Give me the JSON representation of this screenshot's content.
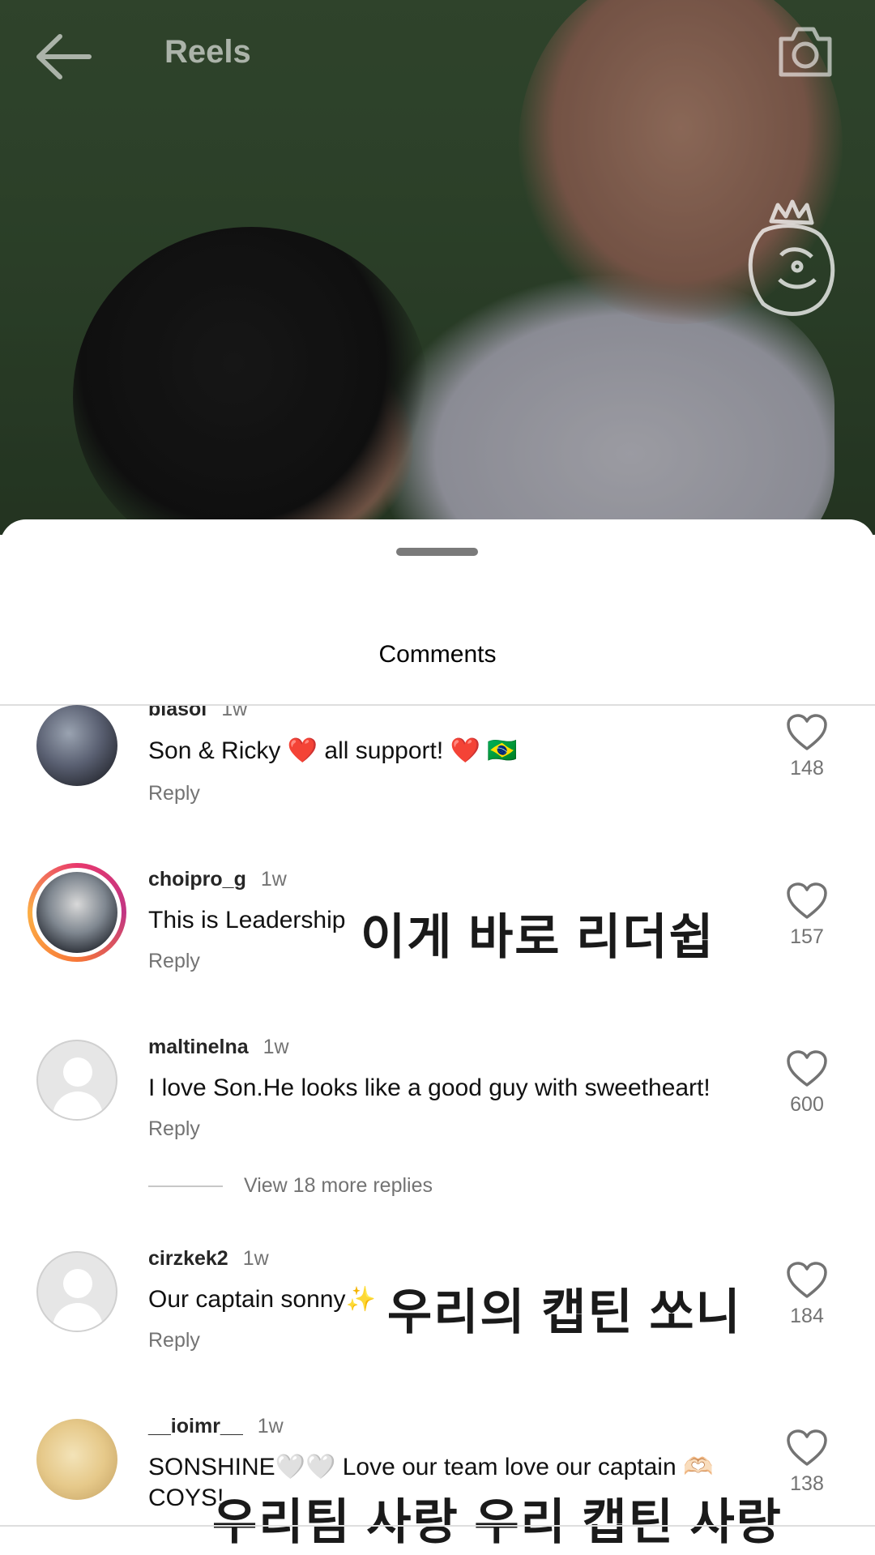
{
  "header": {
    "title": "Reels",
    "back_icon": "arrow-left-icon",
    "camera_icon": "camera-icon"
  },
  "sheet": {
    "title": "Comments"
  },
  "comments": [
    {
      "username": "biasol",
      "time": "1w",
      "text": "Son & Ricky ❤️ all support! ❤️ 🇧🇷",
      "reply": "Reply",
      "likes": "148"
    },
    {
      "username": "choipro_g",
      "time": "1w",
      "text": "This is Leadership",
      "overlay": "이게 바로 리더쉽",
      "reply": "Reply",
      "likes": "157"
    },
    {
      "username": "maltinelna",
      "time": "1w",
      "text": "I love Son.He looks like a good guy with sweetheart!",
      "reply": "Reply",
      "likes": "600",
      "view_replies": "View 18 more replies"
    },
    {
      "username": "cirzkek2",
      "time": "1w",
      "text": "Our captain sonny✨",
      "overlay": "우리의 캡틴 쏘니",
      "reply": "Reply",
      "likes": "184"
    },
    {
      "username": "__ioimr__",
      "time": "1w",
      "text_line1": "SONSHINE🤍🤍 Love our team love our captain 🫶🏻",
      "text_line2": "COYS!",
      "overlay": "우리팀 사랑 우리 캡틴 사랑",
      "likes": "138"
    }
  ],
  "colors": {
    "text_primary": "#262626",
    "text_secondary": "#737373",
    "divider": "#dedede",
    "story_ring": "#c13584"
  }
}
